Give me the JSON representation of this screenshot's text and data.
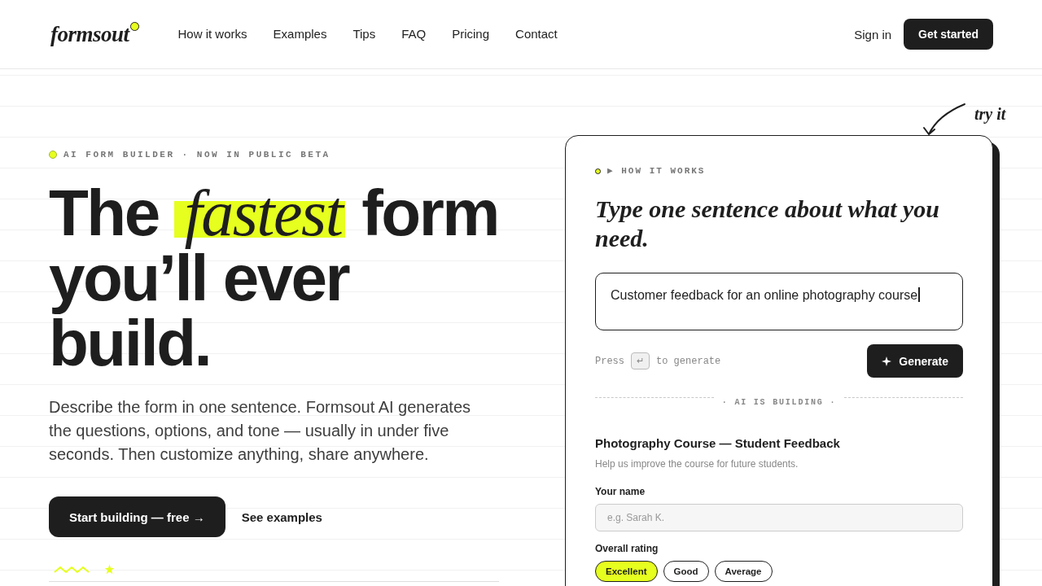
{
  "header": {
    "logo": "formsout",
    "nav": [
      "How it works",
      "Examples",
      "Tips",
      "FAQ",
      "Pricing",
      "Contact"
    ],
    "sign_in": "Sign in",
    "cta": "Get started"
  },
  "hero": {
    "eyebrow": "AI FORM BUILDER · NOW IN PUBLIC BETA",
    "headline": "The *fastest* form\nyou’ll ever\nbuild.",
    "description": "Describe the form in one sentence. Formsout AI generates the questions, options, and tone — usually in under five seconds. Then customize anything, share anywhere.",
    "primary_button": "Start building — free →",
    "secondary_link": "See examples"
  },
  "demo": {
    "annotation": "try it",
    "eyebrow": "▶ HOW IT WORKS",
    "heading": "Type one sentence about what you need.",
    "prompt": {
      "value": "Customer feedback for an online photography course"
    },
    "hint": {
      "before": "Press",
      "key": "↵",
      "after": "to generate"
    },
    "generate_button": "Generate",
    "status": "· AI IS BUILDING ·",
    "form": {
      "title": "Photography Course — Student Feedback",
      "subtitle": "Help us improve the course for future students.",
      "fields": [
        {
          "kind": "text",
          "label": "Your name",
          "placeholder": "e.g. Sarah K."
        },
        {
          "kind": "choice",
          "label": "Overall rating",
          "options": [
            {
              "label": "Excellent",
              "selected": true
            },
            {
              "label": "Good",
              "selected": false
            },
            {
              "label": "Average",
              "selected": false
            }
          ]
        }
      ]
    }
  }
}
